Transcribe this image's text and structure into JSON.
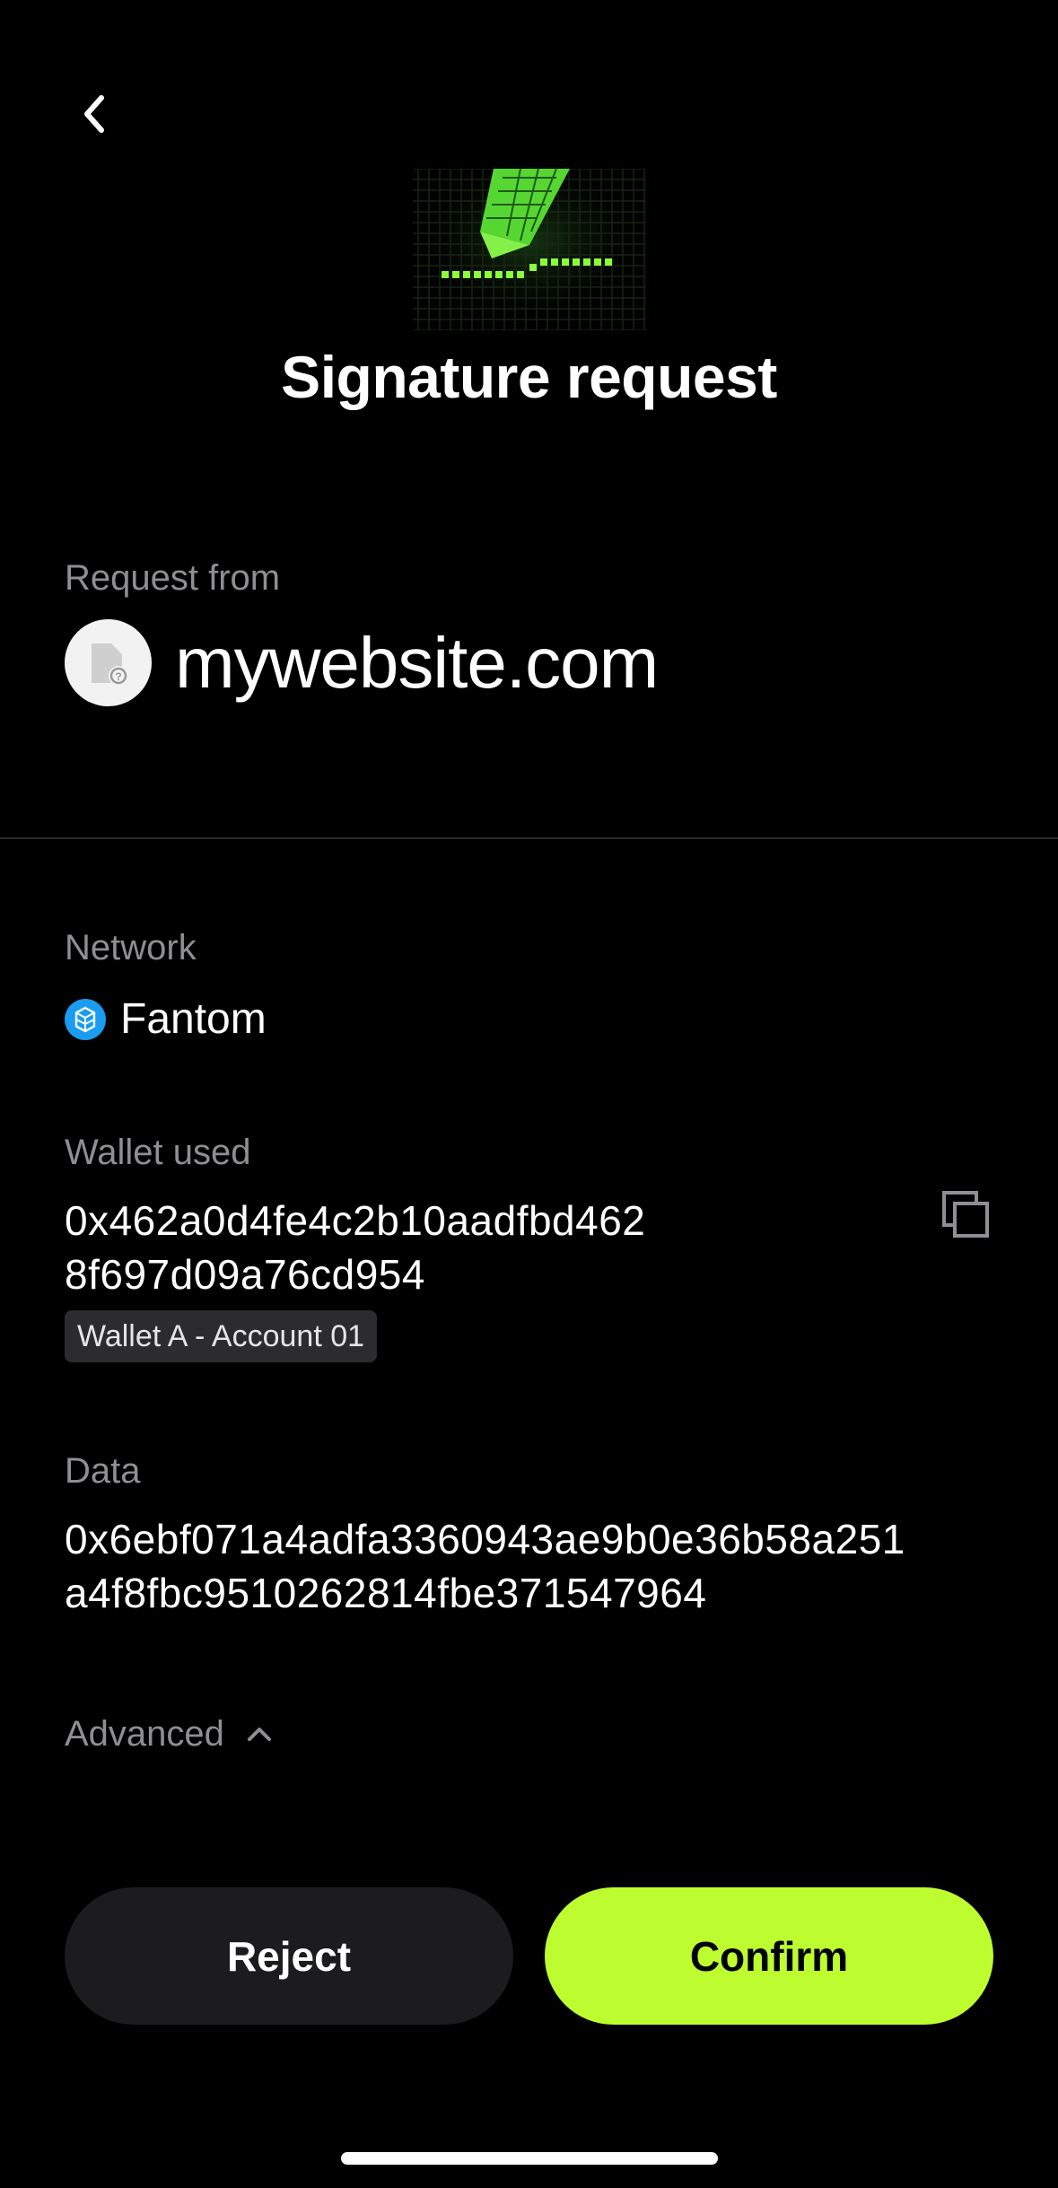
{
  "header": {
    "back_icon": "chevron-left-icon",
    "hero_icon": "pixel-pen-signature-icon",
    "title": "Signature request"
  },
  "request": {
    "label": "Request from",
    "site_icon": "unknown-site-icon",
    "site_name": "mywebsite.com"
  },
  "network": {
    "label": "Network",
    "icon": "fantom-logo-icon",
    "name": "Fantom"
  },
  "wallet": {
    "label": "Wallet used",
    "address_line1": "0x462a0d4fe4c2b10aadfbd462",
    "address_line2": "8f697d09a76cd954",
    "copy_icon": "copy-icon",
    "account_name": "Wallet A - Account 01"
  },
  "data": {
    "label": "Data",
    "line1": "0x6ebf071a4adfa3360943ae9b0e36b58a251",
    "line2": "a4f8fbc9510262814fbe371547964"
  },
  "advanced": {
    "label": "Advanced",
    "icon": "chevron-up-icon"
  },
  "actions": {
    "reject_label": "Reject",
    "confirm_label": "Confirm"
  },
  "colors": {
    "background": "#000000",
    "accent": "#bdfc2f",
    "muted_text": "#8e8e93",
    "reject_bg": "#1c1c1e",
    "fantom_blue": "#1a9cf0"
  }
}
